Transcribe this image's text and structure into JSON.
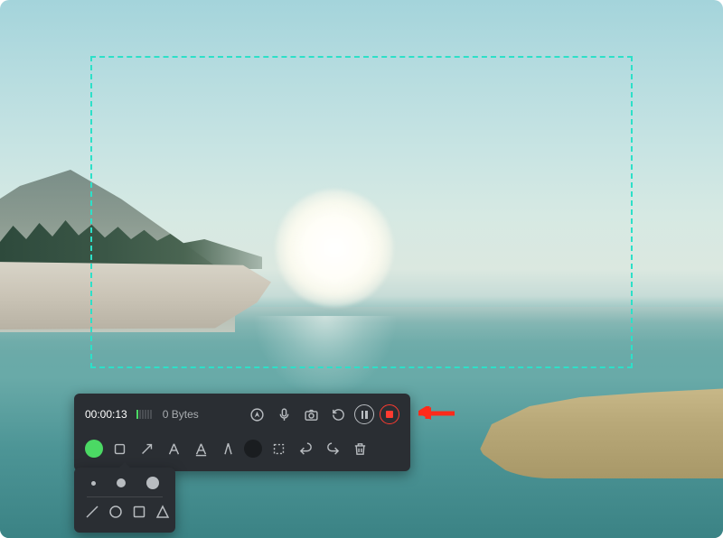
{
  "recording": {
    "timer": "00:00:13",
    "file_size": "0 Bytes",
    "audio_levels": [
      true,
      false,
      false,
      false,
      false,
      false
    ]
  },
  "toolbar_top_icons": [
    {
      "name": "cursor-highlight-icon"
    },
    {
      "name": "microphone-icon"
    },
    {
      "name": "camera-icon"
    },
    {
      "name": "reset-icon"
    },
    {
      "name": "pause-icon",
      "special": "pause"
    },
    {
      "name": "stop-icon",
      "special": "stop"
    }
  ],
  "toolbar_bottom_icons": [
    {
      "name": "color-swatch-green",
      "type": "swatch-green"
    },
    {
      "name": "rectangle-tool-icon"
    },
    {
      "name": "arrow-tool-icon"
    },
    {
      "name": "text-tool-icon"
    },
    {
      "name": "highlight-tool-icon"
    },
    {
      "name": "draw-tool-icon"
    },
    {
      "name": "color-swatch-dark",
      "type": "swatch-dark"
    },
    {
      "name": "marquee-tool-icon"
    },
    {
      "name": "undo-icon"
    },
    {
      "name": "redo-icon"
    },
    {
      "name": "trash-icon"
    }
  ],
  "popup": {
    "sizes": [
      "small",
      "medium",
      "large"
    ],
    "shapes": [
      "line",
      "circle",
      "square",
      "triangle"
    ]
  },
  "colors": {
    "accent_green": "#4bd964",
    "stop_red": "#ff3b30",
    "capture_border": "#2de0c8"
  }
}
